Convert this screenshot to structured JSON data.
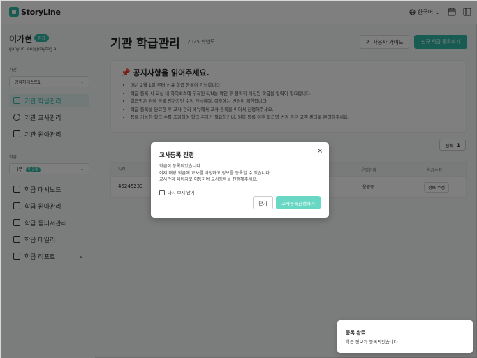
{
  "app": {
    "logo": "StoryLine"
  },
  "topbar": {
    "language": "한국어",
    "chevron": "⌄"
  },
  "sidebar": {
    "user_name": "이가현",
    "user_badge": "원장",
    "user_email": "ganyun.lee@playtag.ai",
    "org_label": "기관",
    "org_select": "공유하테스트1",
    "items_org": [
      {
        "label": "기관 학급관리",
        "icon": "users-icon"
      },
      {
        "label": "기관 교사관리",
        "icon": "teacher-icon"
      },
      {
        "label": "기관 원아관리",
        "icon": "child-icon"
      }
    ],
    "class_label": "학급",
    "class_select": "나무",
    "class_badge": "만3세",
    "items_class": [
      {
        "label": "학급 대시보드",
        "icon": "dashboard-icon"
      },
      {
        "label": "학급 원아관리",
        "icon": "child-icon"
      },
      {
        "label": "학급 동의서관리",
        "icon": "folder-icon"
      },
      {
        "label": "학급 데일리",
        "icon": "daily-icon"
      },
      {
        "label": "학급 리포트",
        "icon": "report-icon"
      }
    ]
  },
  "main": {
    "title": "기관 학급관리",
    "year": "2025 학년도",
    "guide_button": "사용자 가이드",
    "register_button": "신규 학급 등록하기",
    "notice_title": "📌 공지사항을 읽어주세요.",
    "notice_items": [
      "매년 2월 1일 부터 신규 학급 등록이 가능합니다.",
      "학급 등록 시 교실 내 하이박스에 부착된 S/N을 확인 후 정확히 매칭된 학급을 입력이 필요합니다.",
      "학급명은 원아 등록 전까지만 수정 가능하며, 이후에는 변경이 제한됩니다.",
      "학급 등록을 완료한 후 교사 관리 메뉴에서 교사 등록을 이어서 진행해주세요.",
      "등록 가능한 학급 수를 초과하여 학급 추가가 필요하거나, 원아 등록 이후 학급명 변경 등은 고객 센터로 문의해주세요."
    ],
    "total_label": "전체",
    "total_count": "1",
    "table": {
      "headers": [
        "S/N",
        "운영현황",
        "학급수정"
      ],
      "row": {
        "sn": "45245233",
        "status": "운영중",
        "action": "정보 수정"
      }
    }
  },
  "modal": {
    "title": "교사등록 진행",
    "close": "×",
    "body": [
      "학급이 등록되었습니다.",
      "이제 해당 학급에 교사를 배정하고 정보를 등록할 수 있습니다.",
      "교사관리 페이지로 이동하여 교사등록을 진행해주세요."
    ],
    "checkbox_label": "다시 보지 않기",
    "close_button": "닫기",
    "confirm_button": "교사등록진행하기"
  },
  "toast": {
    "title": "등록 완료",
    "message": "학급 정보가 등록되었습니다."
  },
  "colors": {
    "accent": "#2fb6a5",
    "accent_light": "#68d7c4"
  }
}
